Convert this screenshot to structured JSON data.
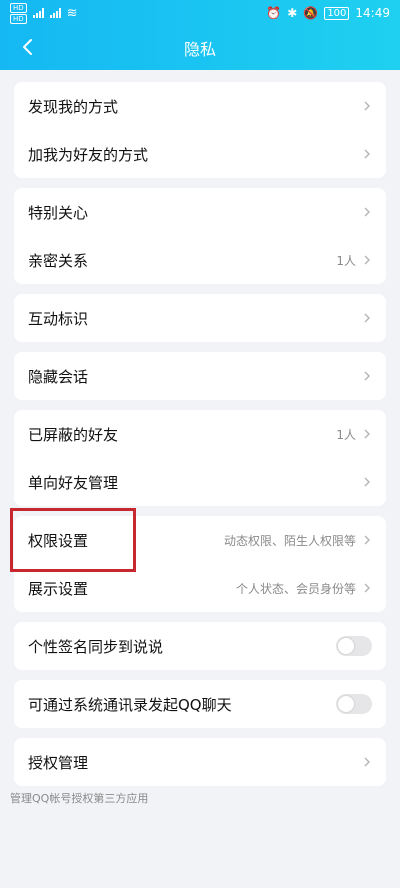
{
  "status": {
    "sims": [
      "HD",
      "HD"
    ],
    "time": "14:49",
    "battery": "100"
  },
  "nav": {
    "title": "隐私"
  },
  "groups": [
    {
      "rows": [
        {
          "label": "发现我的方式",
          "value": ""
        },
        {
          "label": "加我为好友的方式",
          "value": ""
        }
      ]
    },
    {
      "rows": [
        {
          "label": "特别关心",
          "value": ""
        },
        {
          "label": "亲密关系",
          "value": "1人"
        }
      ]
    },
    {
      "rows": [
        {
          "label": "互动标识",
          "value": ""
        }
      ]
    },
    {
      "rows": [
        {
          "label": "隐藏会话",
          "value": ""
        }
      ]
    },
    {
      "rows": [
        {
          "label": "已屏蔽的好友",
          "value": "1人"
        },
        {
          "label": "单向好友管理",
          "value": ""
        }
      ]
    },
    {
      "rows": [
        {
          "label": "权限设置",
          "value": "动态权限、陌生人权限等"
        },
        {
          "label": "展示设置",
          "value": "个人状态、会员身份等"
        }
      ]
    },
    {
      "rows": [
        {
          "label": "个性签名同步到说说",
          "toggle": false
        }
      ]
    },
    {
      "rows": [
        {
          "label": "可通过系统通讯录发起QQ聊天",
          "toggle": false
        }
      ]
    },
    {
      "rows": [
        {
          "label": "授权管理",
          "value": ""
        }
      ]
    }
  ],
  "footnote": "管理QQ帐号授权第三方应用",
  "colors": {
    "header_start": "#15b8f3",
    "header_end": "#1fd0f0",
    "highlight": "#c7272e"
  }
}
